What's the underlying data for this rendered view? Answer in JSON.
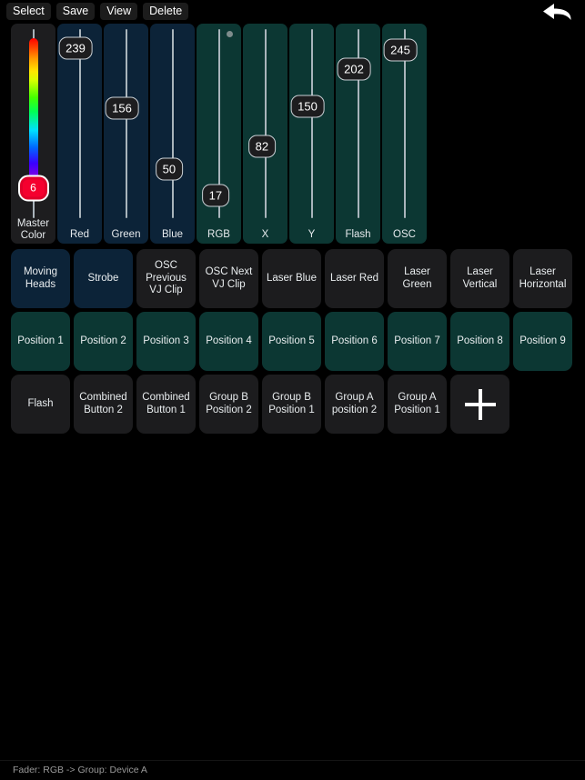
{
  "toolbar": {
    "buttons": [
      {
        "label": "Select"
      },
      {
        "label": "Save"
      },
      {
        "label": "View"
      },
      {
        "label": "Delete"
      }
    ],
    "undo_icon": "back-arrow-icon"
  },
  "faders": [
    {
      "name": "Master Color",
      "value": "6",
      "style": "master",
      "value_pct": 84,
      "dot": false
    },
    {
      "name": "Red",
      "value": "239",
      "style": "blue",
      "value_pct": 10,
      "dot": false
    },
    {
      "name": "Green",
      "value": "156",
      "style": "blue",
      "value_pct": 42,
      "dot": false
    },
    {
      "name": "Blue",
      "value": "50",
      "style": "blue",
      "value_pct": 74,
      "dot": false
    },
    {
      "name": "RGB",
      "value": "17",
      "style": "teal",
      "value_pct": 88,
      "dot": true
    },
    {
      "name": "X",
      "value": "82",
      "style": "teal",
      "value_pct": 62,
      "dot": false
    },
    {
      "name": "Y",
      "value": "150",
      "style": "teal",
      "value_pct": 41,
      "dot": false
    },
    {
      "name": "Flash",
      "value": "202",
      "style": "teal",
      "value_pct": 21,
      "dot": false
    },
    {
      "name": "OSC",
      "value": "245",
      "style": "teal",
      "value_pct": 11,
      "dot": false
    }
  ],
  "grid": {
    "rows": [
      [
        {
          "label": "Moving Heads",
          "style": "navy"
        },
        {
          "label": "Strobe",
          "style": "navy"
        },
        {
          "label": "OSC Previous VJ Clip",
          "style": "dark"
        },
        {
          "label": "OSC Next VJ Clip",
          "style": "dark"
        },
        {
          "label": "Laser Blue",
          "style": "dark"
        },
        {
          "label": "Laser Red",
          "style": "dark"
        },
        {
          "label": "Laser Green",
          "style": "dark"
        },
        {
          "label": "Laser Vertical",
          "style": "dark"
        },
        {
          "label": "Laser Horizontal",
          "style": "dark"
        }
      ],
      [
        {
          "label": "Position 1",
          "style": "teal"
        },
        {
          "label": "Position 2",
          "style": "teal"
        },
        {
          "label": "Position 3",
          "style": "teal"
        },
        {
          "label": "Position 4",
          "style": "teal"
        },
        {
          "label": "Position 5",
          "style": "teal"
        },
        {
          "label": "Position 6",
          "style": "teal"
        },
        {
          "label": "Position 7",
          "style": "teal"
        },
        {
          "label": "Position 8",
          "style": "teal"
        },
        {
          "label": "Position 9",
          "style": "teal"
        }
      ],
      [
        {
          "label": "Flash",
          "style": "dark"
        },
        {
          "label": "Combined Button 2",
          "style": "dark"
        },
        {
          "label": "Combined Button 1",
          "style": "dark"
        },
        {
          "label": "Group B Position 2",
          "style": "dark"
        },
        {
          "label": "Group B Position 1",
          "style": "dark"
        },
        {
          "label": "Group A position 2",
          "style": "dark"
        },
        {
          "label": "Group A Position 1",
          "style": "dark"
        },
        {
          "label": "",
          "style": "dark",
          "icon": "plus-icon"
        },
        {
          "label": "",
          "style": "empty"
        }
      ]
    ]
  },
  "statusbar": {
    "text": "Fader: RGB -> Group: Device A"
  },
  "colors": {
    "background": "#000000",
    "button_dark": "#1c1c1e",
    "button_navy": "#0c2338",
    "button_teal": "#0c3733",
    "master_thumb": "#f5002f",
    "track": "#a9b4bb"
  }
}
